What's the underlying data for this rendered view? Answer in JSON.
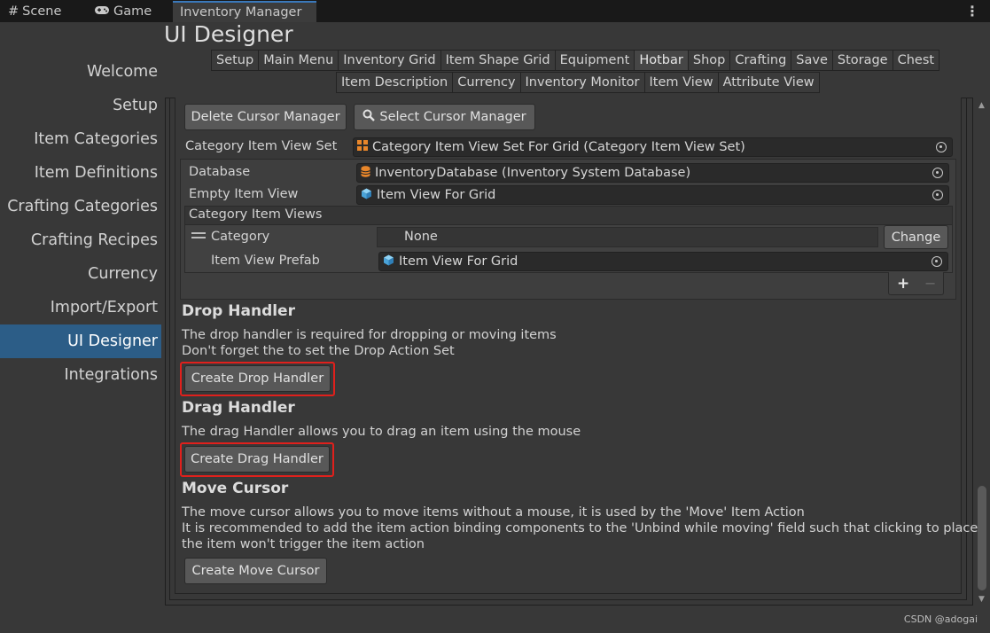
{
  "tabs": {
    "scene": "Scene",
    "game": "Game",
    "active": "Inventory Manager"
  },
  "sidebar": {
    "items": [
      {
        "label": "Welcome"
      },
      {
        "label": "Setup"
      },
      {
        "label": "Item Categories"
      },
      {
        "label": "Item Definitions"
      },
      {
        "label": "Crafting Categories"
      },
      {
        "label": "Crafting Recipes"
      },
      {
        "label": "Currency"
      },
      {
        "label": "Import/Export"
      },
      {
        "label": "UI Designer"
      },
      {
        "label": "Integrations"
      }
    ],
    "active_item": "UI Designer"
  },
  "main": {
    "title": "UI Designer",
    "tabs_row1": [
      "Setup",
      "Main Menu",
      "Inventory Grid",
      "Item Shape Grid",
      "Equipment",
      "Hotbar",
      "Shop",
      "Crafting",
      "Save",
      "Storage",
      "Chest"
    ],
    "tabs_row2": [
      "Item Description",
      "Currency",
      "Inventory Monitor",
      "Item View",
      "Attribute View"
    ],
    "selected_tab": "Hotbar"
  },
  "cursor_manager": {
    "delete_label": "Delete Cursor Manager",
    "select_label": "Select Cursor Manager"
  },
  "props": {
    "category_item_view_set_label": "Category Item View Set",
    "category_item_view_set_value": "Category Item View Set For Grid (Category Item View Set)",
    "database_label": "Database",
    "database_value": "InventoryDatabase (Inventory System Database)",
    "empty_item_view_label": "Empty Item View",
    "empty_item_view_value": "Item View For Grid",
    "category_item_views_label": "Category Item Views",
    "category_label": "Category",
    "category_value": "None",
    "change_label": "Change",
    "item_view_prefab_label": "Item View Prefab",
    "item_view_prefab_value": "Item View For Grid",
    "add_symbol": "+",
    "remove_symbol": "−"
  },
  "drop_handler": {
    "title": "Drop Handler",
    "line1": "The drop handler is required for dropping or moving items",
    "line2": "Don't forget the to set the Drop Action Set",
    "button": "Create Drop Handler"
  },
  "drag_handler": {
    "title": "Drag Handler",
    "line1": "The drag Handler allows you to drag an item using the mouse",
    "button": "Create Drag Handler"
  },
  "move_cursor": {
    "title": "Move Cursor",
    "line1": "The move cursor allows you to move items without a mouse, it is used by the 'Move' Item Action",
    "line2": "It is recommended to add the item action binding components to the 'Unbind while moving' field such that clicking to place",
    "line3": "the item won't trigger the item action",
    "button": "Create Move Cursor"
  },
  "watermark": "CSDN @adogai",
  "colors": {
    "accent": "#2c5d87",
    "highlight": "#e0201c",
    "tab_accent": "#3a79bb"
  }
}
